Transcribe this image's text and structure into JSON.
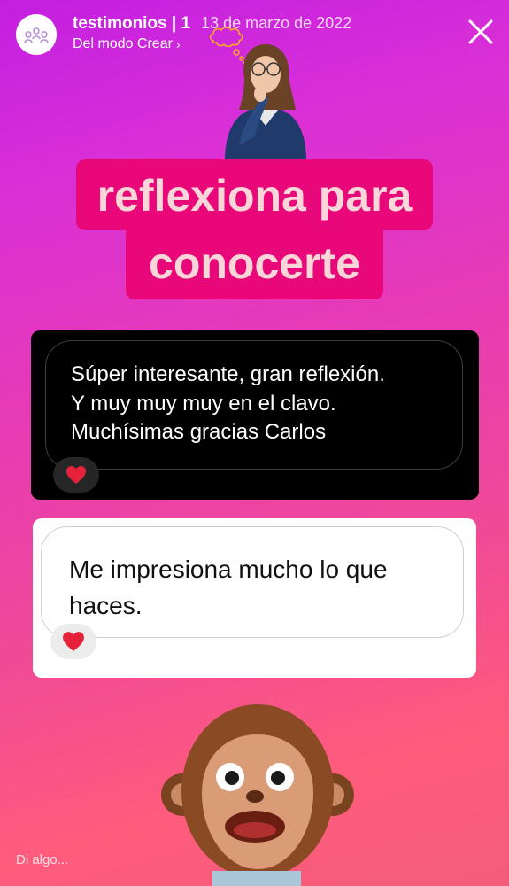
{
  "header": {
    "username": "testimonios | 1",
    "date": "13 de marzo de 2022",
    "source": "Del modo Crear",
    "source_chevron": "›"
  },
  "title": {
    "line1": "reflexiona para",
    "line2": "conocerte"
  },
  "responses": [
    {
      "line1": "Súper interesante, gran reflexión.",
      "line2": "Y muy muy muy en el clavo.",
      "line3": "Muchísimas gracias Carlos",
      "reaction": "heart-icon"
    },
    {
      "line1": "Me impresiona mucho lo que",
      "line2": "haces.",
      "reaction": "heart-icon"
    }
  ],
  "reply": {
    "placeholder": "Di algo..."
  },
  "colors": {
    "title_bg": "#e8087a",
    "title_text": "#fbd6d8",
    "heart": "#e8213a"
  }
}
